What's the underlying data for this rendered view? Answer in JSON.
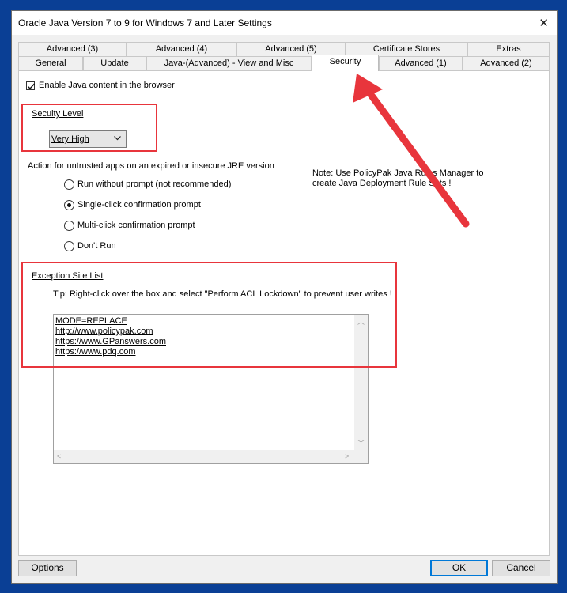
{
  "window": {
    "title": "Oracle Java Version 7 to 9 for Windows 7 and Later Settings"
  },
  "tabs_row1": [
    {
      "label": "Advanced (3)"
    },
    {
      "label": "Advanced (4)"
    },
    {
      "label": "Advanced (5)"
    },
    {
      "label": "Certificate Stores"
    },
    {
      "label": "Extras"
    }
  ],
  "tabs_row2": [
    {
      "label": "General"
    },
    {
      "label": "Update"
    },
    {
      "label": "Java-(Advanced) - View and Misc"
    },
    {
      "label": "Security",
      "active": true
    },
    {
      "label": "Advanced (1)"
    },
    {
      "label": "Advanced (2)"
    }
  ],
  "security": {
    "enable_checkbox": {
      "label": "Enable Java content in the browser",
      "checked": true
    },
    "level_label": "Secuity Level",
    "level_value": "Very High",
    "action_label": "Action for untrusted apps on an expired or insecure JRE version",
    "radios": [
      {
        "label": "Run without prompt (not recommended)",
        "selected": false
      },
      {
        "label": "Single-click confirmation prompt",
        "selected": true
      },
      {
        "label": "Multi-click confirmation prompt",
        "selected": false
      },
      {
        "label": "Don't Run",
        "selected": false
      }
    ],
    "note_line1": "Note: Use PolicyPak Java Rules Manager to",
    "note_line2": "create Java Deployment Rule Sets !",
    "exception_label": "Exception Site List",
    "tip": "Tip: Right-click over the box and select \"Perform ACL Lockdown\" to prevent user writes !",
    "site_list": [
      "MODE=REPLACE",
      "http://www.policypak.com",
      "https://www.GPanswers.com",
      "https://www.pdq.com"
    ]
  },
  "buttons": {
    "options": "Options",
    "ok": "OK",
    "cancel": "Cancel"
  },
  "colors": {
    "highlight_red": "#e8353c",
    "background_blue": "#0a3f95"
  }
}
